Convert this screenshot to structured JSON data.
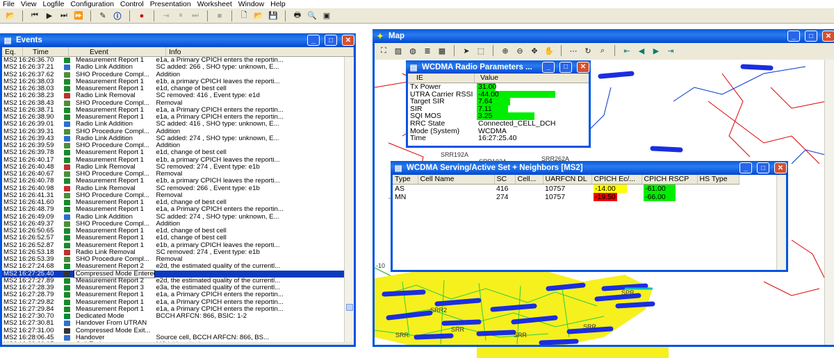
{
  "menu": [
    "File",
    "View",
    "Logfile",
    "Configuration",
    "Control",
    "Presentation",
    "Worksheet",
    "Window",
    "Help"
  ],
  "events_window": {
    "title": "Events",
    "columns": [
      "Eq.",
      "Time",
      "Event",
      "Info"
    ],
    "rows": [
      {
        "eq": "MS2",
        "time": "16:26:36.70",
        "icon": "measurement-report-icon",
        "event": "Measurement Report 1",
        "info": "e1a, a Primary CPICH enters the reportin..."
      },
      {
        "eq": "MS2",
        "time": "16:26:37.21",
        "icon": "radio-link-addition-icon",
        "event": "Radio Link Addition",
        "info": "SC added: 266 , SHO type: unknown, E..."
      },
      {
        "eq": "MS2",
        "time": "16:26:37.62",
        "icon": "sho-procedure-icon",
        "event": "SHO Procedure Compl...",
        "info": "Addition"
      },
      {
        "eq": "MS2",
        "time": "16:26:38.03",
        "icon": "measurement-report-icon",
        "event": "Measurement Report 1",
        "info": "e1b, a primary CPICH leaves the reporti..."
      },
      {
        "eq": "MS2",
        "time": "16:26:38.03",
        "icon": "measurement-report-icon",
        "event": "Measurement Report 1",
        "info": "e1d, change of best cell"
      },
      {
        "eq": "MS2",
        "time": "16:26:38.23",
        "icon": "radio-link-removal-icon",
        "event": "Radio Link Removal",
        "info": "SC removed: 416 , Event type: e1d"
      },
      {
        "eq": "MS2",
        "time": "16:26:38.43",
        "icon": "sho-procedure-icon",
        "event": "SHO Procedure Compl...",
        "info": "Removal"
      },
      {
        "eq": "MS2",
        "time": "16:26:38.71",
        "icon": "measurement-report-icon",
        "event": "Measurement Report 1",
        "info": "e1a, a Primary CPICH enters the reportin..."
      },
      {
        "eq": "MS2",
        "time": "16:26:38.90",
        "icon": "measurement-report-icon",
        "event": "Measurement Report 1",
        "info": "e1a, a Primary CPICH enters the reportin..."
      },
      {
        "eq": "MS2",
        "time": "16:26:39.01",
        "icon": "radio-link-addition-icon",
        "event": "Radio Link Addition",
        "info": "SC added: 416 , SHO type: unknown, E..."
      },
      {
        "eq": "MS2",
        "time": "16:26:39.31",
        "icon": "sho-procedure-icon",
        "event": "SHO Procedure Compl...",
        "info": "Addition"
      },
      {
        "eq": "MS2",
        "time": "16:26:39.43",
        "icon": "radio-link-addition-icon",
        "event": "Radio Link Addition",
        "info": "SC added: 274 , SHO type: unknown, E..."
      },
      {
        "eq": "MS2",
        "time": "16:26:39.59",
        "icon": "sho-procedure-icon",
        "event": "SHO Procedure Compl...",
        "info": "Addition"
      },
      {
        "eq": "MS2",
        "time": "16:26:39.78",
        "icon": "measurement-report-icon",
        "event": "Measurement Report 1",
        "info": "e1d, change of best cell"
      },
      {
        "eq": "MS2",
        "time": "16:26:40.17",
        "icon": "measurement-report-icon",
        "event": "Measurement Report 1",
        "info": "e1b, a primary CPICH leaves the reporti..."
      },
      {
        "eq": "MS2",
        "time": "16:26:40.48",
        "icon": "radio-link-removal-icon",
        "event": "Radio Link Removal",
        "info": "SC removed: 274 , Event type: e1b"
      },
      {
        "eq": "MS2",
        "time": "16:26:40.67",
        "icon": "sho-procedure-icon",
        "event": "SHO Procedure Compl...",
        "info": "Removal"
      },
      {
        "eq": "MS2",
        "time": "16:26:40.78",
        "icon": "measurement-report-icon",
        "event": "Measurement Report 1",
        "info": "e1b, a primary CPICH leaves the reporti..."
      },
      {
        "eq": "MS2",
        "time": "16:26:40.98",
        "icon": "radio-link-removal-icon",
        "event": "Radio Link Removal",
        "info": "SC removed: 266 , Event type: e1b"
      },
      {
        "eq": "MS2",
        "time": "16:26:41.31",
        "icon": "sho-procedure-icon",
        "event": "SHO Procedure Compl...",
        "info": "Removal"
      },
      {
        "eq": "MS2",
        "time": "16:26:41.60",
        "icon": "measurement-report-icon",
        "event": "Measurement Report 1",
        "info": "e1d, change of best cell"
      },
      {
        "eq": "MS2",
        "time": "16:26:48.79",
        "icon": "measurement-report-icon",
        "event": "Measurement Report 1",
        "info": "e1a, a Primary CPICH enters the reportin..."
      },
      {
        "eq": "MS2",
        "time": "16:26:49.09",
        "icon": "radio-link-addition-icon",
        "event": "Radio Link Addition",
        "info": "SC added: 274 , SHO type: unknown, E..."
      },
      {
        "eq": "MS2",
        "time": "16:26:49.37",
        "icon": "sho-procedure-icon",
        "event": "SHO Procedure Compl...",
        "info": "Addition"
      },
      {
        "eq": "MS2",
        "time": "16:26:50.65",
        "icon": "measurement-report-icon",
        "event": "Measurement Report 1",
        "info": "e1d, change of best cell"
      },
      {
        "eq": "MS2",
        "time": "16:26:52.57",
        "icon": "measurement-report-icon",
        "event": "Measurement Report 1",
        "info": "e1d, change of best cell"
      },
      {
        "eq": "MS2",
        "time": "16:26:52.87",
        "icon": "measurement-report-icon",
        "event": "Measurement Report 1",
        "info": "e1b, a primary CPICH leaves the reporti..."
      },
      {
        "eq": "MS2",
        "time": "16:26:53.18",
        "icon": "radio-link-removal-icon",
        "event": "Radio Link Removal",
        "info": "SC removed: 274 , Event type: e1b"
      },
      {
        "eq": "MS2",
        "time": "16:26:53.39",
        "icon": "sho-procedure-icon",
        "event": "SHO Procedure Compl...",
        "info": "Removal"
      },
      {
        "eq": "MS2",
        "time": "16:27:24.68",
        "icon": "measurement-report-icon",
        "event": "Measurement Report 2",
        "info": "e2d, the estimated quality of the currentl..."
      },
      {
        "eq": "MS2",
        "time": "16:27:25.40",
        "icon": "compressed-mode-icon",
        "event": "Compressed Mode Entered",
        "info": "",
        "selected": true
      },
      {
        "eq": "MS2",
        "time": "16:27:27.89",
        "icon": "measurement-report-icon",
        "event": "Measurement Report 2",
        "info": "e2d, the estimated quality of the currentl..."
      },
      {
        "eq": "MS2",
        "time": "16:27:28.39",
        "icon": "measurement-report-icon",
        "event": "Measurement Report 3",
        "info": "e3a, the estimated quality of the currentl..."
      },
      {
        "eq": "MS2",
        "time": "16:27:28.79",
        "icon": "measurement-report-icon",
        "event": "Measurement Report 1",
        "info": "e1a, a Primary CPICH enters the reportin..."
      },
      {
        "eq": "MS2",
        "time": "16:27:29.82",
        "icon": "measurement-report-icon",
        "event": "Measurement Report 1",
        "info": "e1a, a Primary CPICH enters the reportin..."
      },
      {
        "eq": "MS2",
        "time": "16:27:29.84",
        "icon": "measurement-report-icon",
        "event": "Measurement Report 1",
        "info": "e1a, a Primary CPICH enters the reportin..."
      },
      {
        "eq": "MS2",
        "time": "16:27:30.70",
        "icon": "dedicated-mode-icon",
        "event": "Dedicated Mode",
        "info": "BCCH ARFCN: 866, BSIC: 1-2"
      },
      {
        "eq": "MS2",
        "time": "16:27:30.81",
        "icon": "handover-icon",
        "event": "Handover From UTRAN",
        "info": ""
      },
      {
        "eq": "MS2",
        "time": "16:27:31.00",
        "icon": "compressed-mode-icon",
        "event": "Compressed Mode Exit...",
        "info": ""
      },
      {
        "eq": "MS2",
        "time": "16:28:06.45",
        "icon": "handover-icon",
        "event": "Handover",
        "info": "Source cell,  BCCH ARFCN: 866,  BS..."
      },
      {
        "eq": "MS2",
        "time": "16:28:22.95",
        "icon": "call-end-icon",
        "event": "Call End",
        "info": "MS initiated release"
      }
    ]
  },
  "map_window": {
    "title": "Map",
    "labels": [
      "SRR192A",
      "SRR192A",
      "SRR262A",
      "SRR2",
      "SRR",
      "SRR",
      "SRR",
      "SRR",
      "SPR",
      "-10"
    ]
  },
  "radio_params": {
    "title": "WCDMA Radio Parameters ...",
    "columns": [
      "IE",
      "Value"
    ],
    "rows": [
      {
        "ie": "Tx Power",
        "value": "31.00",
        "bar": 0.18,
        "color": "#00ee00"
      },
      {
        "ie": "UTRA Carrier RSSI",
        "value": "-44.00",
        "bar": 0.75,
        "color": "#00ee00"
      },
      {
        "ie": "Target SIR",
        "value": "7.64",
        "bar": 0.32,
        "color": "#00ee00"
      },
      {
        "ie": "SIR",
        "value": "7.11",
        "bar": 0.3,
        "color": "#00ee00"
      },
      {
        "ie": "SQI MOS",
        "value": "3.25",
        "bar": 0.55,
        "color": "#00ee00"
      },
      {
        "ie": "RRC State",
        "value": "Connected_CELL_DCH"
      },
      {
        "ie": "Mode (System)",
        "value": "WCDMA"
      },
      {
        "ie": "Time",
        "value": "16:27:25.40"
      }
    ]
  },
  "serving_set": {
    "title": "WCDMA Serving/Active Set + Neighbors [MS2]",
    "columns": [
      "Type",
      "Cell Name",
      "SC",
      "Cell...",
      "UARFCN DL",
      "CPICH Ec/...",
      "CPICH RSCP",
      "HS Type"
    ],
    "rows": [
      {
        "type": "AS",
        "cell": "",
        "sc": "416",
        "cellx": "",
        "uarfcn": "10757",
        "ecno": "-14.00",
        "ecno_color": "#ffff00",
        "rscp": "-61.00",
        "rscp_color": "#00ee00",
        "hs": ""
      },
      {
        "type": "MN",
        "cell": "",
        "sc": "274",
        "cellx": "",
        "uarfcn": "10757",
        "ecno": "-19.50",
        "ecno_color": "#ee0000",
        "rscp": "-66.00",
        "rscp_color": "#00ee00",
        "hs": ""
      }
    ]
  }
}
